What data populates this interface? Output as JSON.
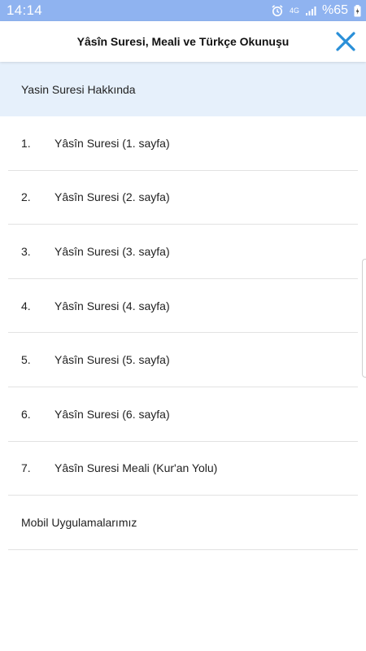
{
  "status_bar": {
    "time": "14:14",
    "network_label": "4G",
    "battery": "%65",
    "bg_color": "#8fb3f0",
    "icons": [
      "alarm-icon",
      "network-4g-icon",
      "signal-icon",
      "battery-icon"
    ]
  },
  "header": {
    "title": "Yâsîn Suresi, Meali ve Türkçe Okunuşu",
    "close_icon": "close-icon",
    "close_color": "#2a8fd8"
  },
  "about": {
    "label": "Yasin Suresi Hakkında",
    "bg_color": "#e6f0fb"
  },
  "menu": {
    "items": [
      {
        "num": "1.",
        "label": "Yâsîn Suresi (1. sayfa)"
      },
      {
        "num": "2.",
        "label": "Yâsîn Suresi (2. sayfa)"
      },
      {
        "num": "3.",
        "label": "Yâsîn Suresi (3. sayfa)"
      },
      {
        "num": "4.",
        "label": "Yâsîn Suresi (4. sayfa)"
      },
      {
        "num": "5.",
        "label": "Yâsîn Suresi (5. sayfa)"
      },
      {
        "num": "6.",
        "label": "Yâsîn Suresi (6. sayfa)"
      },
      {
        "num": "7.",
        "label": "Yâsîn Suresi Meali (Kur'an Yolu)"
      }
    ],
    "apps_label": "Mobil Uygulamalarımız"
  }
}
